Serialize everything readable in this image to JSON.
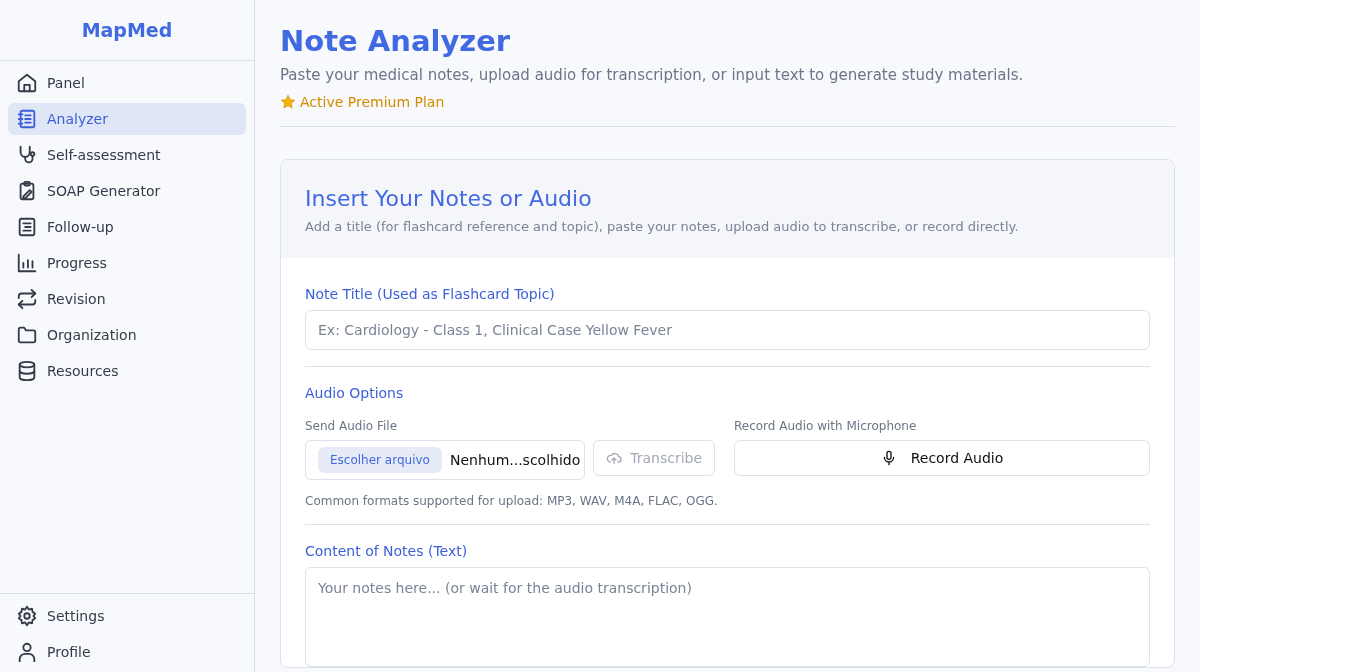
{
  "sidebar": {
    "brand": "MapMed",
    "items": [
      {
        "label": "Panel",
        "selected": false
      },
      {
        "label": "Analyzer",
        "selected": true
      },
      {
        "label": "Self-assessment",
        "selected": false
      },
      {
        "label": "SOAP Generator",
        "selected": false
      },
      {
        "label": "Follow-up",
        "selected": false
      },
      {
        "label": "Progress",
        "selected": false
      },
      {
        "label": "Revision",
        "selected": false
      },
      {
        "label": "Organization",
        "selected": false
      },
      {
        "label": "Resources",
        "selected": false
      }
    ],
    "footer_items": [
      {
        "label": "Settings"
      },
      {
        "label": "Profile"
      }
    ]
  },
  "header": {
    "title": "Note Analyzer",
    "subtitle": "Paste your medical notes, upload audio for transcription, or input text to generate study materials.",
    "plan": "Active Premium Plan"
  },
  "card": {
    "title": "Insert Your Notes or Audio",
    "description": "Add a title (for flashcard reference and topic), paste your notes, upload audio to transcribe, or record directly.",
    "note_title": {
      "label": "Note Title (Used as Flashcard Topic)",
      "placeholder": "Ex: Cardiology - Class 1, Clinical Case Yellow Fever"
    },
    "audio": {
      "heading": "Audio Options",
      "send_label": "Send Audio File",
      "choose_button": "Escolher arquivo",
      "file_name": "Nenhum...scolhido",
      "transcribe": {
        "label": "Transcribe",
        "disabled": true
      },
      "record_label": "Record Audio with Microphone",
      "record_button": "Record Audio",
      "formats": "Common formats supported for upload: MP3, WAV, M4A, FLAC, OGG."
    },
    "content": {
      "label": "Content of Notes (Text)",
      "placeholder": "Your notes here... (or wait for the audio transcription)"
    }
  }
}
